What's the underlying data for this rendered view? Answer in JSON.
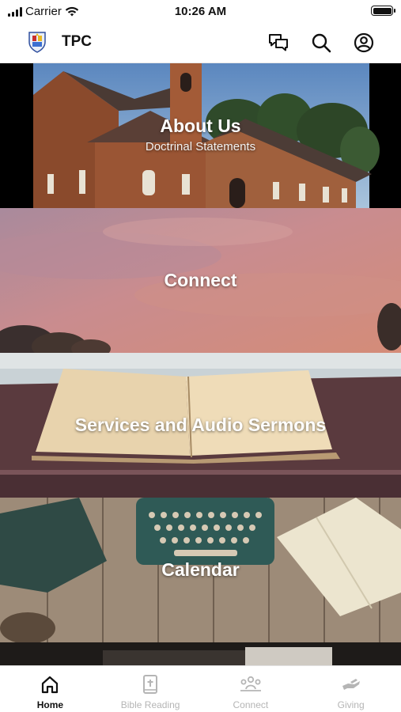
{
  "status_bar": {
    "carrier": "Carrier",
    "time": "10:26 AM"
  },
  "header": {
    "title": "TPC",
    "icons": [
      "logo-crest",
      "chat-bubbles-icon",
      "search-icon",
      "account-icon"
    ]
  },
  "tiles": [
    {
      "title": "About Us",
      "subtitle": "Doctrinal Statements"
    },
    {
      "title": "Connect",
      "subtitle": ""
    },
    {
      "title": "Services and Audio Sermons",
      "subtitle": ""
    },
    {
      "title": "Calendar",
      "subtitle": ""
    }
  ],
  "tab_bar": {
    "tabs": [
      {
        "label": "Home",
        "icon": "home-icon",
        "active": true
      },
      {
        "label": "Bible Reading",
        "icon": "bible-icon",
        "active": false
      },
      {
        "label": "Connect",
        "icon": "people-icon",
        "active": false
      },
      {
        "label": "Giving",
        "icon": "giving-hand-icon",
        "active": false
      }
    ]
  },
  "colors": {
    "active": "#111111",
    "inactive": "#b5b5b5",
    "header_bg": "#ffffff"
  }
}
